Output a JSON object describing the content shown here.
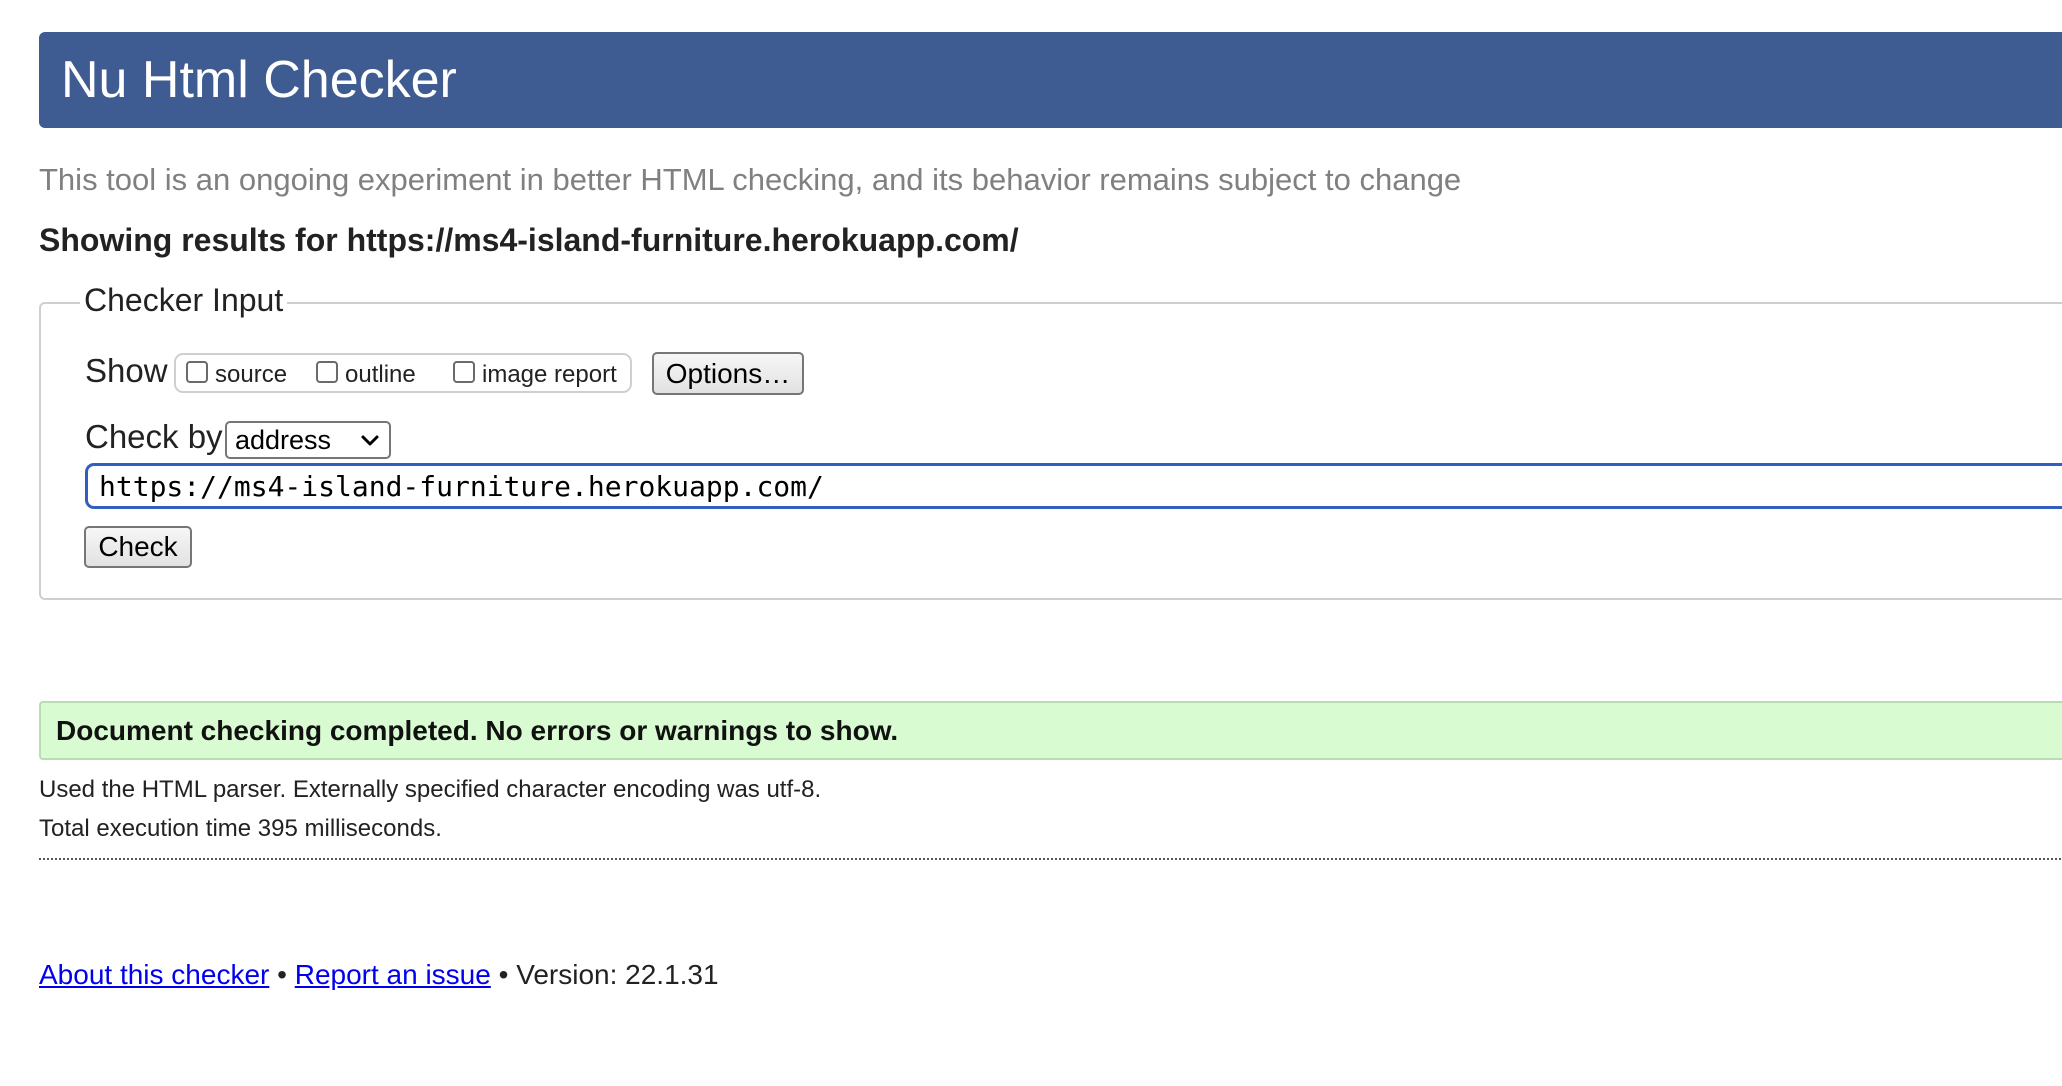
{
  "header": {
    "title": "Nu Html Checker"
  },
  "tagline": "This tool is an ongoing experiment in better HTML checking, and its behavior remains subject to change",
  "results_heading": "Showing results for https://ms4-island-furniture.herokuapp.com/",
  "checker_input": {
    "legend": "Checker Input",
    "show_label": "Show",
    "show_options": [
      {
        "label": "source",
        "checked": false
      },
      {
        "label": "outline",
        "checked": false
      },
      {
        "label": "image report",
        "checked": false
      }
    ],
    "options_button": "Options…",
    "check_by_label": "Check by",
    "check_by_selected": "address",
    "url_value": "https://ms4-island-furniture.herokuapp.com/",
    "check_button": "Check"
  },
  "result": {
    "message": "Document checking completed. No errors or warnings to show.",
    "parser_info": "Used the HTML parser. Externally specified character encoding was utf-8.",
    "execution_time": "Total execution time 395 milliseconds."
  },
  "footer": {
    "about_link": "About this checker",
    "separator": " • ",
    "report_link": "Report an issue",
    "version_text": " • Version: 22.1.31"
  },
  "colors": {
    "header_bg": "#3e5c91",
    "success_bg": "#d8fbd1",
    "input_focus_border": "#2f5fc2",
    "link": "#0000ee"
  }
}
